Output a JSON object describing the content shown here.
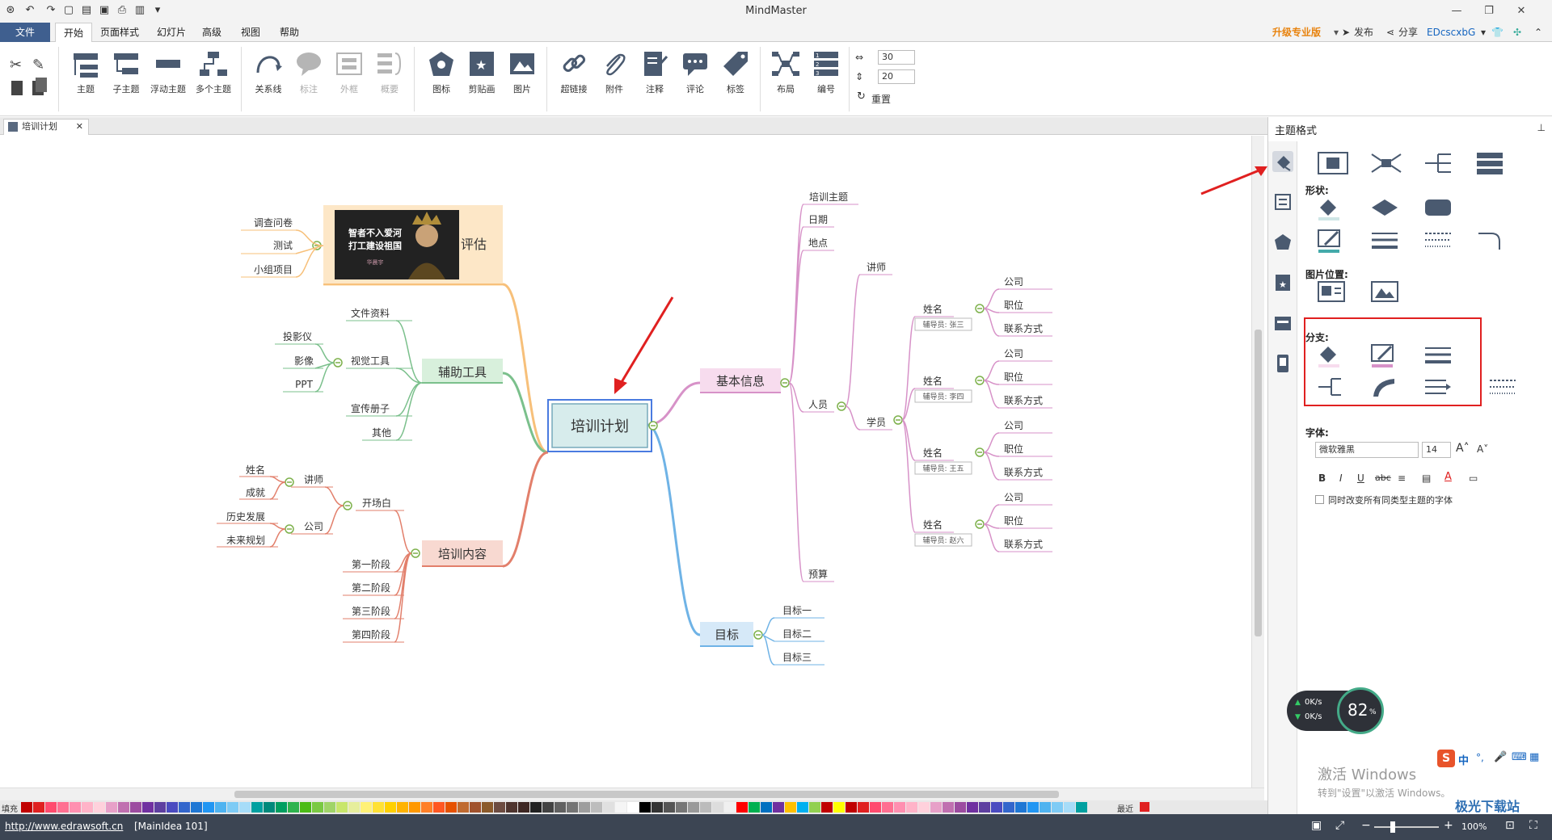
{
  "app": {
    "title": "MindMaster"
  },
  "menu": {
    "file": "文件",
    "tabs": [
      "开始",
      "页面样式",
      "幻灯片",
      "高级",
      "视图",
      "帮助"
    ],
    "upgrade": "升级专业版",
    "publish": "发布",
    "share": "分享",
    "user": "EDcscxbG"
  },
  "ribbon": {
    "topic": "主题",
    "subtopic": "子主题",
    "floating": "浮动主题",
    "multi": "多个主题",
    "relation": "关系线",
    "callout": "标注",
    "boundary": "外框",
    "summary": "概要",
    "icon": "图标",
    "clipart": "剪贴画",
    "image": "图片",
    "hyperlink": "超链接",
    "attachment": "附件",
    "note": "注释",
    "comment": "评论",
    "tag": "标签",
    "layout": "布局",
    "numbering": "编号",
    "spacing_h": "30",
    "spacing_v": "20",
    "reset": "重置"
  },
  "doc_tab": {
    "name": "培训计划"
  },
  "mindmap": {
    "central": "培训计划",
    "eval": {
      "label": "评估",
      "items": [
        "调查问卷",
        "测试",
        "小组项目"
      ],
      "img_line1": "智者不入爱河",
      "img_line2": "打工建设祖国",
      "img_sign": "华晨宇"
    },
    "tools": {
      "label": "辅助工具",
      "items": [
        "文件资料",
        "视觉工具",
        "宣传册子",
        "其他"
      ],
      "visual_sub": [
        "投影仪",
        "影像",
        "PPT"
      ]
    },
    "content": {
      "label": "培训内容",
      "opening": "开场白",
      "opening_sub": [
        "讲师",
        "公司"
      ],
      "lecturer_sub": [
        "姓名",
        "成就"
      ],
      "company_sub": [
        "历史发展",
        "未来规划"
      ],
      "stages": [
        "第一阶段",
        "第二阶段",
        "第三阶段",
        "第四阶段"
      ]
    },
    "basic": {
      "label": "基本信息",
      "items": [
        "培训主题",
        "日期",
        "地点",
        "人员",
        "预算"
      ],
      "lecturer": "讲师",
      "student": "学员",
      "name": "姓名",
      "students": [
        {
          "note": "辅导员: 张三"
        },
        {
          "note": "辅导员: 李四"
        },
        {
          "note": "辅导员: 王五"
        },
        {
          "note": "辅导员: 赵六"
        }
      ],
      "contact_items": [
        "公司",
        "职位",
        "联系方式"
      ]
    },
    "goal": {
      "label": "目标",
      "items": [
        "目标一",
        "目标二",
        "目标三"
      ]
    }
  },
  "panel": {
    "title": "主题格式",
    "shape": "形状:",
    "image_pos": "图片位置:",
    "branch": "分支:",
    "font": "字体:",
    "font_name": "微软雅黑",
    "font_size": "14",
    "same_type_label": "同时改变所有同类型主题的字体"
  },
  "status": {
    "fill": "填充",
    "recent": "最近",
    "url": "http://www.edrawsoft.cn",
    "main_idea": "[MainIdea 101]",
    "zoom": "100%"
  },
  "overlay": {
    "cpu": "82",
    "cpu_unit": "%",
    "up": "0K/s",
    "down": "0K/s",
    "activate1": "激活 Windows",
    "activate2": "转到\"设置\"以激活 Windows。",
    "brand": "极光下载站",
    "ime": "中"
  },
  "colors": {
    "accent": "#3f5f8f",
    "red": "#e02020",
    "eval": "#f7c07a",
    "tools": "#7bc08c",
    "content": "#e27f6b",
    "basic": "#d792c8",
    "goal": "#6fb3e6"
  }
}
